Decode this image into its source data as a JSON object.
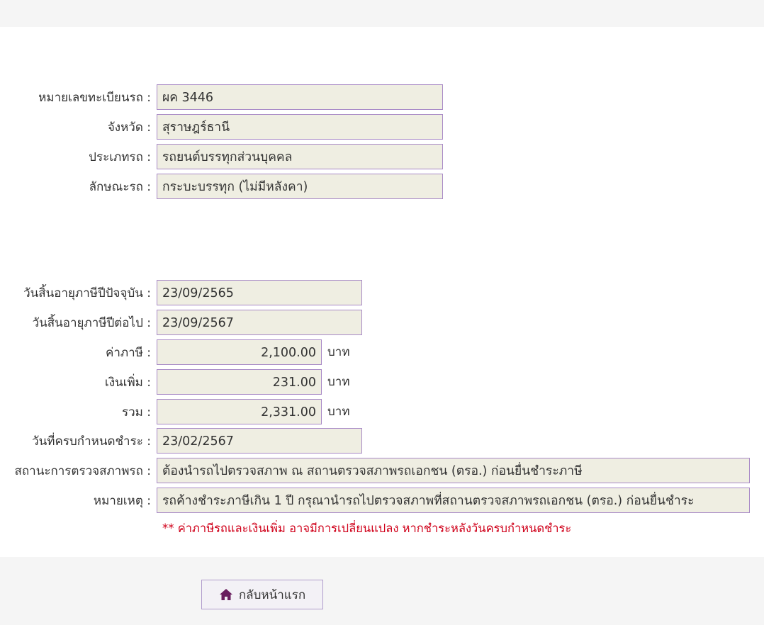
{
  "vehicle": {
    "plate_label": "หมายเลขทะเบียนรถ :",
    "plate_value": "ผค 3446",
    "province_label": "จังหวัด :",
    "province_value": "สุราษฎร์ธานี",
    "type_label": "ประเภทรถ :",
    "type_value": "รถยนต์บรรทุกส่วนบุคคล",
    "body_label": "ลักษณะรถ :",
    "body_value": "กระบะบรรทุก (ไม่มีหลังคา)"
  },
  "tax": {
    "current_expiry_label": "วันสิ้นอายุภาษีปีปัจจุบัน :",
    "current_expiry_value": "23/09/2565",
    "next_expiry_label": "วันสิ้นอายุภาษีปีต่อไป :",
    "next_expiry_value": "23/09/2567",
    "tax_label": "ค่าภาษี :",
    "tax_value": "2,100.00",
    "surcharge_label": "เงินเพิ่ม :",
    "surcharge_value": "231.00",
    "total_label": "รวม :",
    "total_value": "2,331.00",
    "unit": "บาท",
    "due_label": "วันที่ครบกำหนดชำระ :",
    "due_value": "23/02/2567",
    "inspection_label": "สถานะการตรวจสภาพรถ :",
    "inspection_value": "ต้องนำรถไปตรวจสภาพ ณ สถานตรวจสภาพรถเอกชน (ตรอ.) ก่อนยื่นชำระภาษี",
    "remark_label": "หมายเหตุ :",
    "remark_value": "รถค้างชำระภาษีเกิน 1 ปี กรุณานำรถไปตรวจสภาพที่สถานตรวจสภาพรถเอกชน (ตรอ.) ก่อนยื่นชำระ"
  },
  "note": "** ค่าภาษีรถและเงินเพิ่ม อาจมีการเปลี่ยนแปลง หากชำระหลังวันครบกำหนดชำระ",
  "home_button": {
    "label": "กลับหน้าแรก",
    "icon": "home-icon",
    "icon_color": "#6a1f5f"
  },
  "colors": {
    "field_bg": "#efeee2",
    "field_border": "#a889c6",
    "note": "#d0021b"
  }
}
